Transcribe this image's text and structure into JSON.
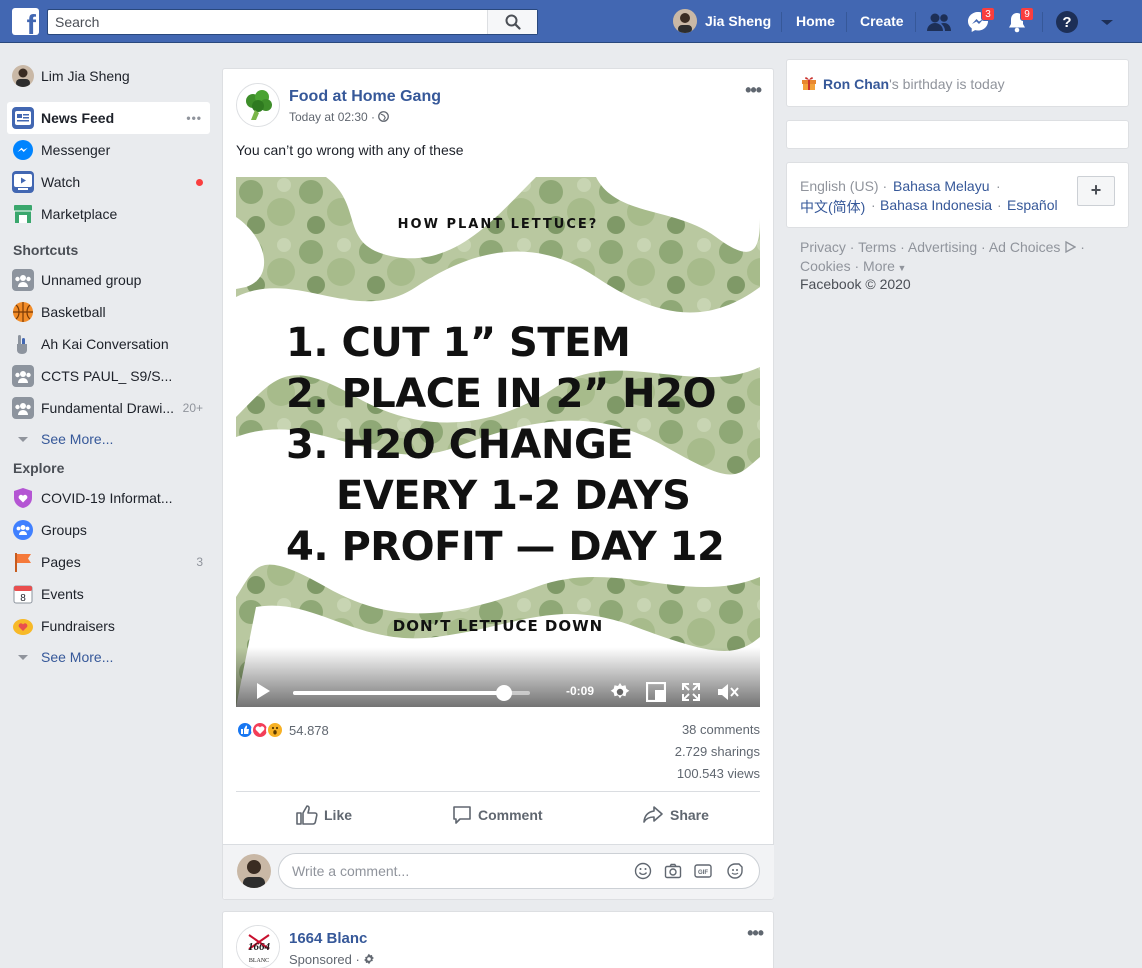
{
  "topbar": {
    "search_placeholder": "Search",
    "profile_name": "Jia Sheng",
    "home_label": "Home",
    "create_label": "Create",
    "messenger_badge": "3",
    "notifications_badge": "9",
    "brand_color": "#4267b2"
  },
  "sidebar": {
    "user_name": "Lim Jia Sheng",
    "main_items": [
      {
        "label": "News Feed",
        "icon": "news-feed-icon",
        "more": "•••"
      },
      {
        "label": "Messenger",
        "icon": "messenger-icon"
      },
      {
        "label": "Watch",
        "icon": "watch-icon"
      },
      {
        "label": "Marketplace",
        "icon": "marketplace-icon"
      }
    ],
    "shortcuts_heading": "Shortcuts",
    "shortcuts": [
      {
        "label": "Unnamed group",
        "icon": "group-icon"
      },
      {
        "label": "Basketball",
        "icon": "basketball-icon"
      },
      {
        "label": "Ah Kai Conversation",
        "icon": "hand-icon"
      },
      {
        "label": "CCTS PAUL_ S9/S...",
        "icon": "group-icon"
      },
      {
        "label": "Fundamental Drawi...",
        "icon": "group-icon",
        "count": "20+"
      }
    ],
    "see_more_1": "See More...",
    "explore_heading": "Explore",
    "explore": [
      {
        "label": "COVID-19 Informat...",
        "icon": "covid-info-icon"
      },
      {
        "label": "Groups",
        "icon": "groups-icon"
      },
      {
        "label": "Pages",
        "icon": "pages-flag-icon",
        "count": "3"
      },
      {
        "label": "Events",
        "icon": "events-calendar-icon"
      },
      {
        "label": "Fundraisers",
        "icon": "fundraisers-icon"
      }
    ],
    "see_more_2": "See More..."
  },
  "post": {
    "page_name": "Food at Home Gang",
    "meta": "Today at 02:30 ·",
    "text": "You can’t go wrong with any of these",
    "video": {
      "title": "HOW PLANT LETTUCE?",
      "steps": [
        "1. CUT 1” STEM",
        "2. PLACE IN 2” H2O",
        "3. H2O CHANGE",
        "EVERY 1-2 DAYS",
        "4. PROFIT — DAY 12"
      ],
      "footer": "DON’T LETTUCE DOWN",
      "time_remaining": "-0:09",
      "progress": 0.89
    },
    "reaction_count": "54.878",
    "comments": "38 comments",
    "sharings": "2.729 sharings",
    "views": "100.543 views",
    "actions": {
      "like": "Like",
      "comment": "Comment",
      "share": "Share"
    },
    "comment_placeholder": "Write a comment..."
  },
  "post2": {
    "page_name": "1664 Blanc",
    "logo_text": "1664",
    "logo_subtext": "BLANC",
    "meta": "Sponsored ·"
  },
  "right": {
    "birthday_name": "Ron Chan",
    "birthday_suffix": "'s birthday is today",
    "languages": {
      "current": "English (US) ·",
      "links": [
        "Bahasa Melayu",
        "中文(简体)",
        "Bahasa Indonesia",
        "Español"
      ]
    },
    "add_language": "+",
    "footer_links": [
      "Privacy",
      "Terms",
      "Advertising",
      "Ad Choices",
      "Cookies",
      "More"
    ],
    "copyright": "Facebook © 2020"
  }
}
